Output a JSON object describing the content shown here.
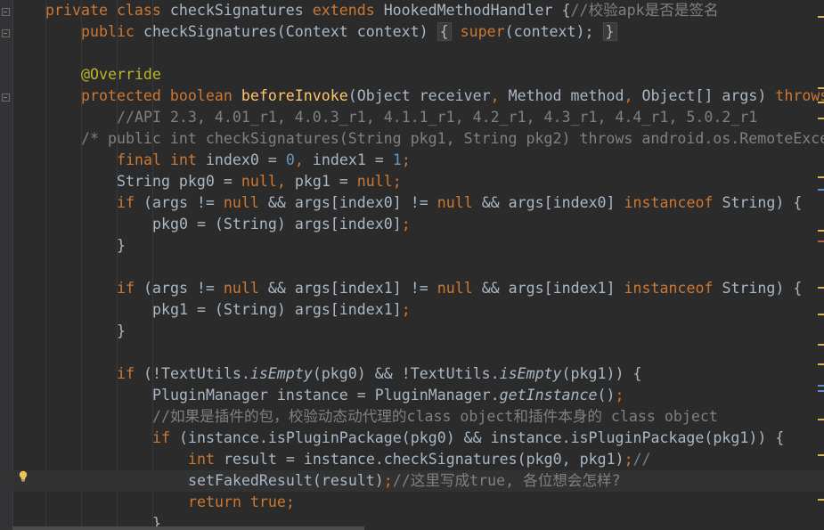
{
  "code": {
    "l1": {
      "private_kw": "private",
      "class_kw": "class",
      "class_name": "checkSignatures",
      "extends_kw": "extends",
      "parent_name": "HookedMethodHandler",
      "brace": "{",
      "comment": "//校验apk是否是签名"
    },
    "l2": {
      "public_kw": "public",
      "ctor_sig": "checkSignatures(Context context)",
      "fold_open": "{",
      "super_kw": "super",
      "super_args": "(context);",
      "fold_close": "}"
    },
    "l4": {
      "annotation": "@Override"
    },
    "l5": {
      "protected_kw": "protected",
      "boolean_kw": "boolean",
      "method_name": "beforeInvoke",
      "params_a": "(Object receiver",
      "comma": ",",
      "params_b": "Method method",
      "params_c": "Object[] args)",
      "throws_kw": "throws"
    },
    "l6": {
      "comment": "//API 2.3, 4.01_r1, 4.0.3_r1, 4.1.1_r1, 4.2_r1, 4.3_r1, 4.4_r1, 5.0.2_r1"
    },
    "l7": {
      "comment": "/* public int checkSignatures(String pkg1, String pkg2) throws android.os.RemoteExce"
    },
    "l8": {
      "final_kw": "final",
      "int_kw": "int",
      "decl_a": "index0 =",
      "zero": "0",
      "decl_b": "index1 =",
      "one": "1",
      "semi": ";"
    },
    "l9": {
      "decl_a": "String pkg0 =",
      "null_kw": "null",
      "decl_b": "pkg1 =",
      "semi": ";"
    },
    "l10": {
      "if_kw": "if",
      "cond_a": "(args !=",
      "null_kw": "null",
      "cond_b": "&& args[index0] !=",
      "cond_c": "&& args[index0]",
      "instanceof_kw": "instanceof",
      "cond_d": "String) {"
    },
    "l11": {
      "assign": "pkg0 = (String) args[index0]",
      "semi": ";"
    },
    "l12": {
      "brace": "}"
    },
    "l14": {
      "if_kw": "if",
      "cond_a": "(args !=",
      "null_kw": "null",
      "cond_b": "&& args[index1] !=",
      "cond_c": "&& args[index1]",
      "instanceof_kw": "instanceof",
      "cond_d": "String) {"
    },
    "l15": {
      "assign": "pkg1 = (String) args[index1]",
      "semi": ";"
    },
    "l16": {
      "brace": "}"
    },
    "l18": {
      "if_kw": "if",
      "cond_a": "(!TextUtils.",
      "is_empty": "isEmpty",
      "cond_b": "(pkg0) && !TextUtils.",
      "cond_c": "(pkg1)) {"
    },
    "l19": {
      "decl": "PluginManager instance = PluginManager.",
      "get_instance": "getInstance",
      "tail": "()",
      "semi": ";"
    },
    "l20": {
      "comment": "//如果是插件的包，校验动态动代理的class object和插件本身的 class object"
    },
    "l21": {
      "if_kw": "if",
      "cond": "(instance.isPluginPackage(pkg0) && instance.isPluginPackage(pkg1)) {"
    },
    "l22": {
      "int_kw": "int",
      "decl": "result = instance.checkSignatures(pkg0, pkg1)",
      "semi": ";",
      "comment": "//"
    },
    "l23": {
      "call": "setFakedResult(result)",
      "semi": ";",
      "comment": "//这里写成true, 各位想会怎样?"
    },
    "l24": {
      "return_kw": "return",
      "true_kw": "true",
      "semi": ";"
    },
    "l25": {
      "brace": "}"
    }
  },
  "icons": {
    "bulb": "lightbulb-icon",
    "fold": "fold-icon"
  },
  "colors": {
    "background": "#2b2b2b",
    "keyword": "#cc7832",
    "comment": "#808080",
    "number": "#6897bb",
    "annotation": "#bbb529",
    "method": "#ffc66d",
    "text": "#a9b7c6"
  }
}
